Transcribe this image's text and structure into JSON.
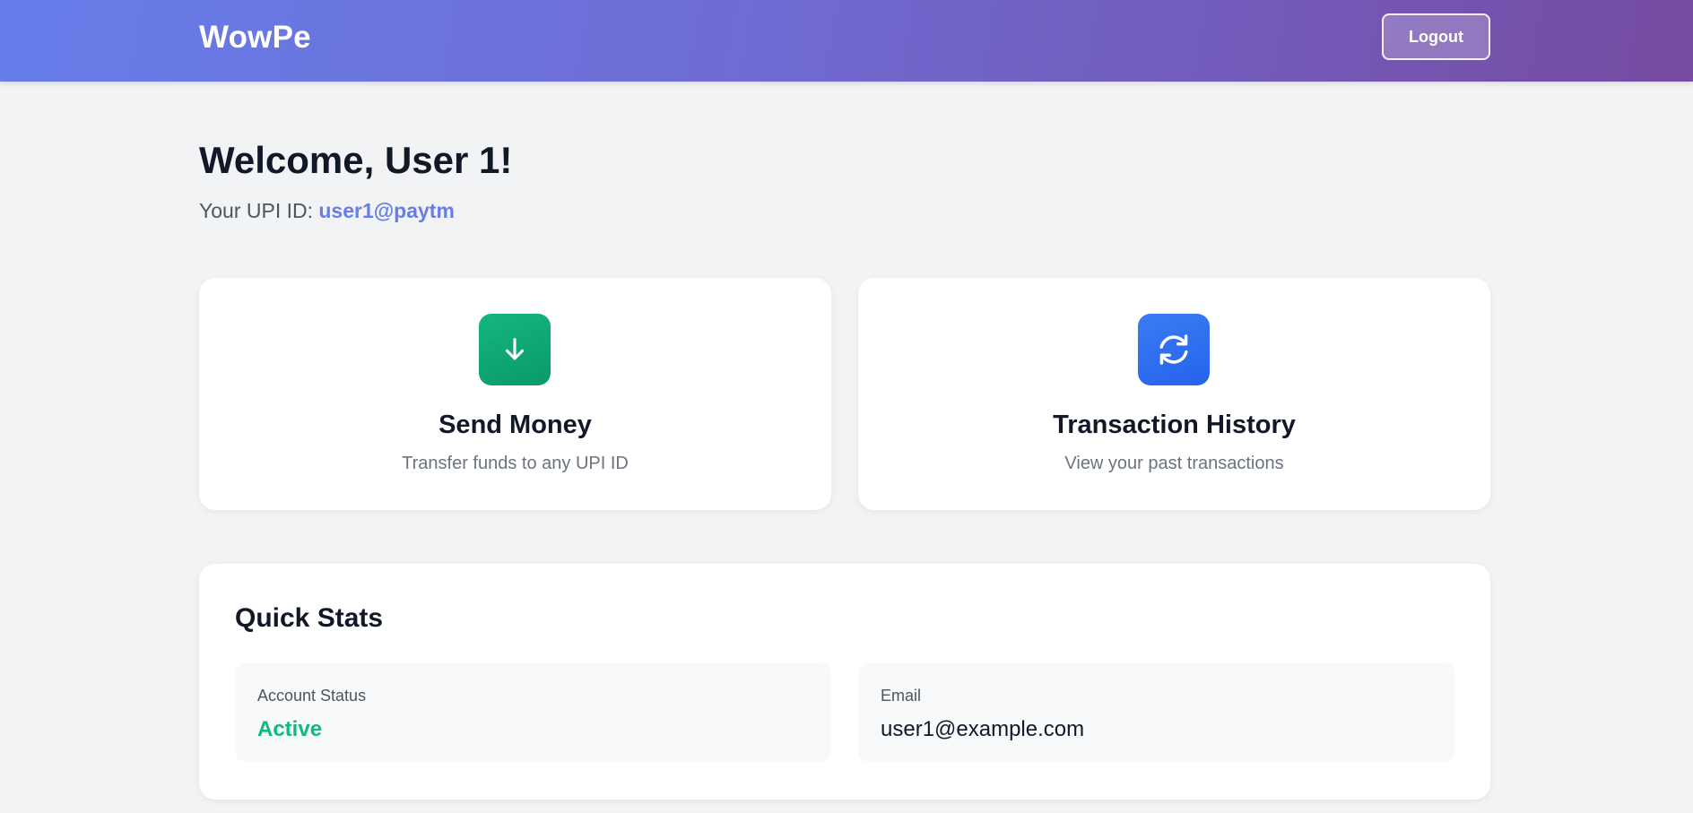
{
  "header": {
    "brand": "WowPe",
    "logout_label": "Logout",
    "gradient_start": "#667eea",
    "gradient_end": "#764ba2"
  },
  "welcome": {
    "heading": "Welcome, User 1!",
    "upi_label": "Your UPI ID:",
    "upi_value": "user1@paytm"
  },
  "actions": [
    {
      "icon": "arrow-down-icon",
      "title": "Send Money",
      "subtitle": "Transfer funds to any UPI ID",
      "color": "#10b981"
    },
    {
      "icon": "refresh-icon",
      "title": "Transaction History",
      "subtitle": "View your past transactions",
      "color": "#2563eb"
    }
  ],
  "quick_stats": {
    "title": "Quick Stats",
    "items": [
      {
        "label": "Account Status",
        "value": "Active",
        "value_color": "#10b981"
      },
      {
        "label": "Email",
        "value": "user1@example.com"
      }
    ]
  }
}
